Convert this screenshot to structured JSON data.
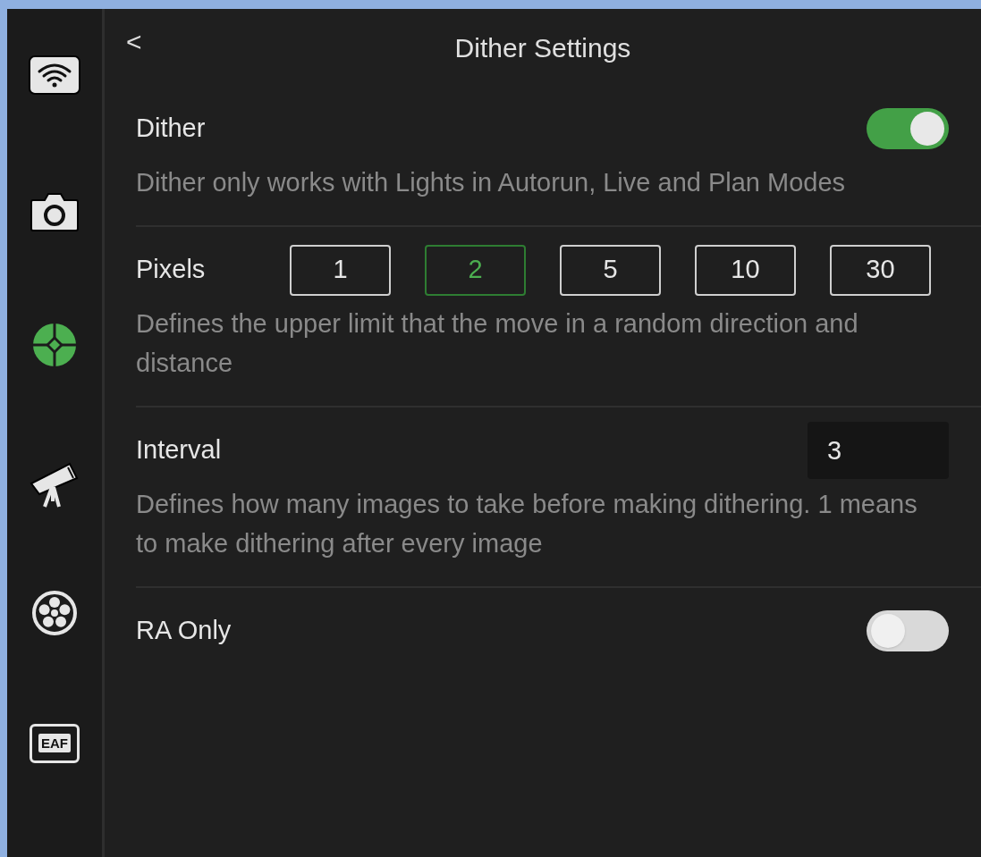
{
  "sidebar": {
    "items": [
      {
        "kind": "wifi",
        "selected": false
      },
      {
        "kind": "camera",
        "selected": false
      },
      {
        "kind": "guide",
        "selected": true
      },
      {
        "kind": "telescope",
        "selected": false
      },
      {
        "kind": "filter_wheel",
        "selected": false
      },
      {
        "kind": "eaf",
        "label": "EAF",
        "selected": false
      }
    ]
  },
  "header": {
    "back": "<",
    "title": "Dither Settings"
  },
  "settings": [
    {
      "kind": "toggle",
      "label": "Dither",
      "on": true,
      "description": "Dither only works with Lights in Autorun, Live and Plan Modes"
    },
    {
      "kind": "choice",
      "label": "Pixels",
      "options": [
        {
          "label": "1",
          "selected": false
        },
        {
          "label": "2",
          "selected": true
        },
        {
          "label": "5",
          "selected": false
        },
        {
          "label": "10",
          "selected": false
        },
        {
          "label": "30",
          "selected": false
        }
      ],
      "description": "Defines the upper limit that the move in a random direction and distance"
    },
    {
      "kind": "number",
      "label": "Interval",
      "value": "3",
      "description": "Defines how many images to take before making dithering. 1 means to make dithering after every image"
    },
    {
      "kind": "toggle",
      "label": "RA Only",
      "on": false
    }
  ]
}
